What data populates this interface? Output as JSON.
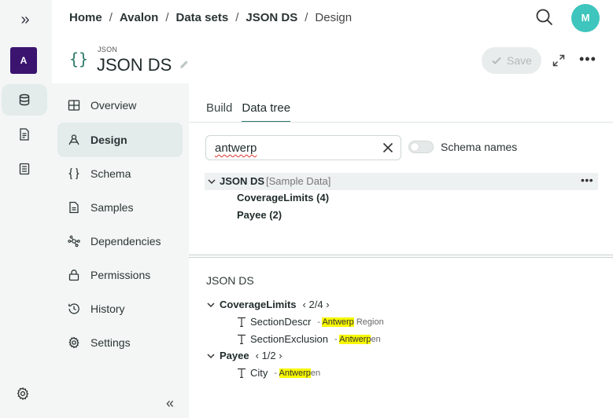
{
  "rail": {
    "org_initial": "A"
  },
  "breadcrumbs": {
    "items": [
      "Home",
      "Avalon",
      "Data sets",
      "JSON DS"
    ],
    "current": "Design",
    "separator": "/"
  },
  "user": {
    "initial": "M"
  },
  "header": {
    "kind": "JSON",
    "title": "JSON DS",
    "icon_glyph": "{}",
    "save_label": "Save"
  },
  "nav": {
    "items": [
      {
        "label": "Overview",
        "icon": "grid-icon"
      },
      {
        "label": "Design",
        "icon": "design-icon",
        "active": true
      },
      {
        "label": "Schema",
        "icon": "braces-icon"
      },
      {
        "label": "Samples",
        "icon": "document-icon"
      },
      {
        "label": "Dependencies",
        "icon": "network-icon"
      },
      {
        "label": "Permissions",
        "icon": "lock-icon"
      },
      {
        "label": "History",
        "icon": "history-icon"
      },
      {
        "label": "Settings",
        "icon": "gear-icon"
      }
    ]
  },
  "tabs": [
    {
      "label": "Build",
      "active": false
    },
    {
      "label": "Data tree",
      "active": true
    }
  ],
  "search": {
    "value": "antwerp",
    "schema_names_label": "Schema names",
    "schema_names_on": false
  },
  "tree": {
    "root_name": "JSON DS",
    "root_tag": "[Sample Data]",
    "children": [
      "CoverageLimits (4)",
      "Payee (2)"
    ]
  },
  "results": {
    "title": "JSON DS",
    "groups": [
      {
        "name": "CoverageLimits",
        "pager": "2/4",
        "fields": [
          {
            "name": "SectionDescr",
            "dash": "-",
            "match": "Antwerp",
            "rest": " Region"
          },
          {
            "name": "SectionExclusion",
            "dash": "-",
            "match": "Antwerp",
            "rest": "en"
          }
        ]
      },
      {
        "name": "Payee",
        "pager": "1/2",
        "fields": [
          {
            "name": "City",
            "dash": "-",
            "match": "Antwerp",
            "rest": "en"
          }
        ]
      }
    ]
  },
  "colors": {
    "accent": "#2c7a6a",
    "avatar": "#3ec5bd",
    "org": "#3b1470",
    "highlight": "#f7f700"
  }
}
